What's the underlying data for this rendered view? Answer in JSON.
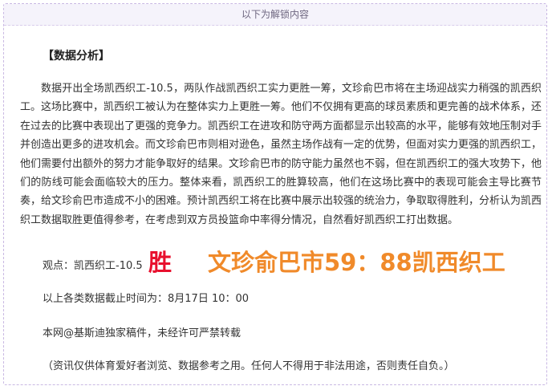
{
  "unlock_banner": "以下为解锁内容",
  "section_title": "【数据分析】",
  "analysis_text": "数据开出全场凯西织工-10.5，两队作战凯西织工实力更胜一筹，文珍俞巴市将在主场迎战实力稍强的凯西织工。这场比赛中，凯西织工被认为在整体实力上更胜一筹。他们不仅拥有更高的球员素质和更完善的战术体系，还在过去的比赛中表现出了更强的竞争力。凯西织工在进攻和防守两方面都显示出较高的水平，能够有效地压制对手并创造出更多的进攻机会。而文珍俞巴市则相对逊色，虽然主场作战有一定的优势，但面对实力更强的凯西织工，他们需要付出额外的努力才能争取好的结果。文珍俞巴市的防守能力虽然也不弱，但在凯西织工的强大攻势下，他们的防线可能会面临较大的压力。整体来看，凯西织工的胜算较高，他们在这场比赛中的表现可能会主导比赛节奏，给文珍俞巴市造成不小的困难。预计凯西织工将在比赛中展示出较强的统治力，争取取得胜利，分析认为凯西织工数据取胜更值得参考，在考虑到双方员投篮命中率得分情况，自然看好凯西织工打出数据。",
  "viewpoint": {
    "label": "观点：凯西织工-10.5",
    "verdict": "胜",
    "score": "文珍俞巴市59：88凯西织工"
  },
  "cutoff_text": "以上各类数据截止时间为：8月17日 10：00",
  "copyright_text": "本网@基斯迪独家稿件，未经许可严禁转载",
  "disclaimer_text": "（资讯仅供体育爱好者浏览、数据参考之用。任何人不得用于非法用途，否则责任自负。）",
  "colors": {
    "verdict": "#e8102e",
    "score": "#f08a2a",
    "border": "#c9b8e3",
    "banner_bg": "#f5f3fb"
  }
}
